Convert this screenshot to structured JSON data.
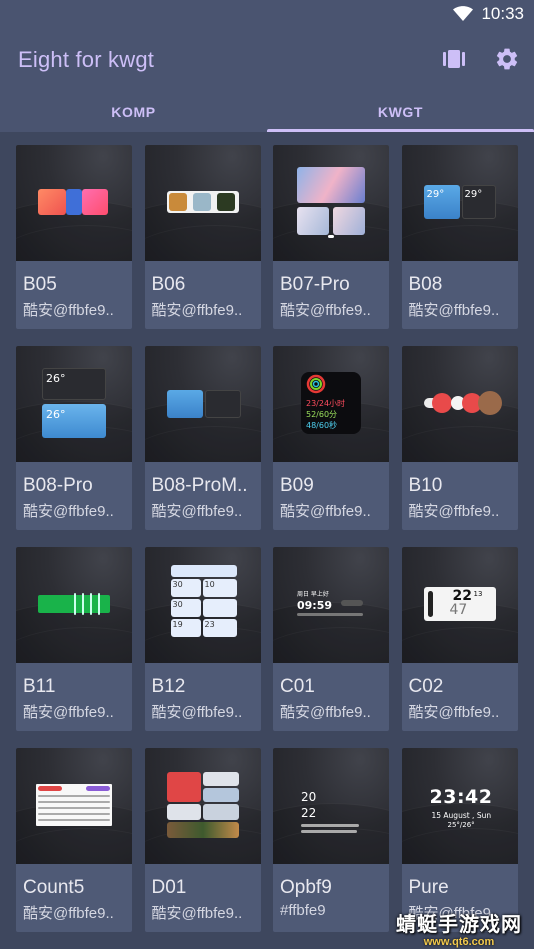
{
  "status_bar": {
    "time": "10:33"
  },
  "app_bar": {
    "title": "Eight for kwgt",
    "tabs": [
      {
        "label": "KOMP"
      },
      {
        "label": "KWGT"
      }
    ]
  },
  "colors": {
    "accent": "#cdbff7",
    "background": "#3e475e",
    "appbar": "#4a5470",
    "card": "#4f5a76"
  },
  "widgets": [
    {
      "name": "B05",
      "author": "酷安@ffbfe9.."
    },
    {
      "name": "B06",
      "author": "酷安@ffbfe9.."
    },
    {
      "name": "B07-Pro",
      "author": "酷安@ffbfe9.."
    },
    {
      "name": "B08",
      "author": "酷安@ffbfe9.."
    },
    {
      "name": "B08-Pro",
      "author": "酷安@ffbfe9.."
    },
    {
      "name": "B08-ProM..",
      "author": "酷安@ffbfe9.."
    },
    {
      "name": "B09",
      "author": "酷安@ffbfe9.."
    },
    {
      "name": "B10",
      "author": "酷安@ffbfe9.."
    },
    {
      "name": "B11",
      "author": "酷安@ffbfe9.."
    },
    {
      "name": "B12",
      "author": "酷安@ffbfe9.."
    },
    {
      "name": "C01",
      "author": "酷安@ffbfe9.."
    },
    {
      "name": "C02",
      "author": "酷安@ffbfe9.."
    },
    {
      "name": "Count5",
      "author": "酷安@ffbfe9.."
    },
    {
      "name": "D01",
      "author": "酷安@ffbfe9.."
    },
    {
      "name": "Opbf9",
      "author": "#ffbfe9"
    },
    {
      "name": "Pure",
      "author": "酷安@ffbfe9.."
    }
  ],
  "previews": {
    "b08_temp1": "29°",
    "b08_temp2": "29°",
    "b08pro_temp1": "26°",
    "b08pro_temp2": "26°",
    "b09_line1": "23/24小时",
    "b09_line2": "52/60分",
    "b09_line3": "48/60秒",
    "b12_n1": "30",
    "b12_n2": "10",
    "b12_n3": "30",
    "b12_n4": "19",
    "b12_n5": "23",
    "c01_date": "周日 早上好",
    "c01_time": "09:59",
    "c02_num1": "22",
    "c02_num2": "13",
    "c02_big": "47",
    "opbf9_hour": "20",
    "opbf9_min": "22",
    "pure_time": "23:42",
    "pure_date": "15 August , Sun",
    "pure_temp": "25°/26°"
  },
  "watermark": {
    "title": "蜻蜓手游戏网",
    "url": "www.qt6.com"
  }
}
